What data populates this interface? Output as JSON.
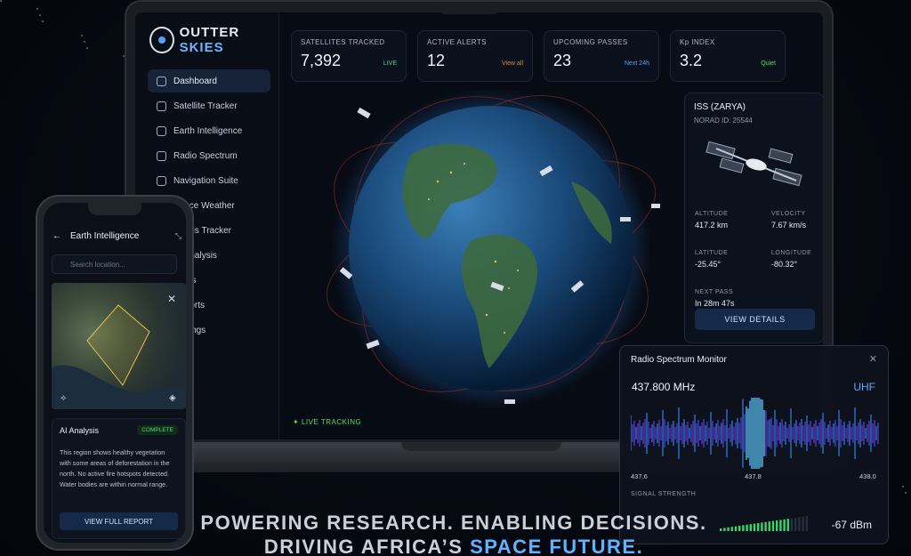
{
  "brand": {
    "word1": "OUTTER",
    "word2": "SKIES"
  },
  "sidebar": {
    "items": [
      {
        "label": "Dashboard",
        "active": true
      },
      {
        "label": "Satellite Tracker"
      },
      {
        "label": "Earth Intelligence"
      },
      {
        "label": "Radio Spectrum"
      },
      {
        "label": "Navigation Suite"
      },
      {
        "label": "Space Weather"
      },
      {
        "label": "Debris Tracker"
      },
      {
        "label": "AI Analysis"
      },
      {
        "label": "Alerts"
      },
      {
        "label": "Reports"
      },
      {
        "label": "Settings"
      }
    ]
  },
  "stats": [
    {
      "label": "SATELLITES TRACKED",
      "value": "7,392",
      "tag_top": "",
      "tag": "LIVE",
      "tag_color": "#4ee06a"
    },
    {
      "label": "ACTIVE ALERTS",
      "value": "12",
      "tag_top": "",
      "tag": "View all",
      "tag_color": "#e0853a"
    },
    {
      "label": "UPCOMING PASSES",
      "value": "23",
      "tag_top": "",
      "tag": "Next 24h",
      "tag_color": "#4da3ff"
    },
    {
      "label": "Kp INDEX",
      "value": "3.2",
      "tag_top": "",
      "tag": "Quiet",
      "tag_color": "#4ee06a"
    }
  ],
  "globe": {
    "live_label": "LIVE TRACKING"
  },
  "iss": {
    "name": "ISS (ZARYA)",
    "norad": "NORAD ID: 25544",
    "altitude_label": "ALTITUDE",
    "altitude": "417.2 km",
    "velocity_label": "VELOCITY",
    "velocity": "7.67 km/s",
    "latitude_label": "LATITUDE",
    "latitude": "-25.45°",
    "longitude_label": "LONGITUDE",
    "longitude": "-80.32°",
    "next_pass_label": "NEXT PASS",
    "next_pass": "In 28m 47s",
    "button": "VIEW DETAILS"
  },
  "phone": {
    "title": "Earth Intelligence",
    "search_placeholder": "Search location...",
    "ai_title": "AI Analysis",
    "ai_status": "COMPLETE",
    "ai_text": "This region shows healthy vegetation with some areas of deforestation in the north. No active fire hotspots detected. Water bodies are within normal range.",
    "button": "VIEW FULL REPORT"
  },
  "radio": {
    "title": "Radio Spectrum Monitor",
    "frequency": "437.800 MHz",
    "band": "UHF",
    "ticks": [
      "437.6",
      "437.8",
      "438.0"
    ],
    "signal_label": "SIGNAL STRENGTH",
    "signal_value": "-67 dBm",
    "signal_level": 0.8
  },
  "tagline": {
    "line1": "POWERING RESEARCH. ENABLING DECISIONS.",
    "line2_a": "DRIVING AFRICA’S ",
    "line2_b": "SPACE FUTURE."
  },
  "colors": {
    "accent": "#4da3ff",
    "live": "#4ee06a",
    "alert": "#e0853a"
  }
}
